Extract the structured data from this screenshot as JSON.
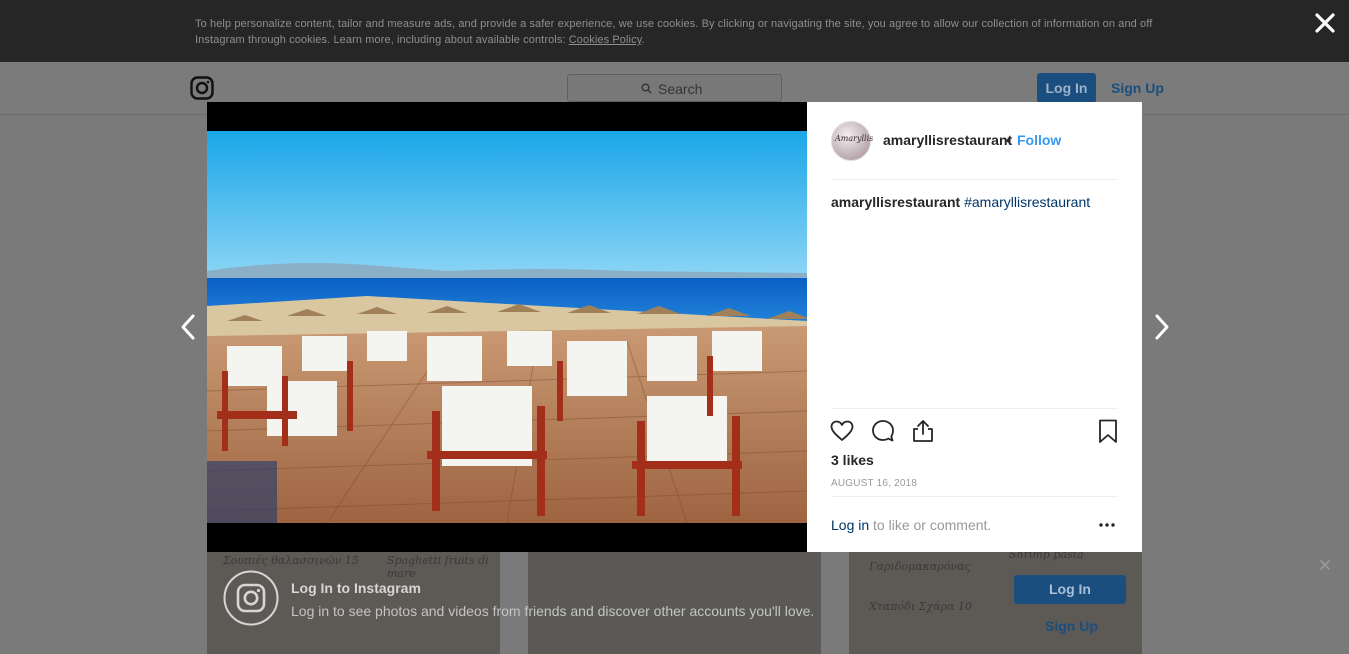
{
  "cookie_banner": {
    "text": "To help personalize content, tailor and measure ads, and provide a safer experience, we use cookies. By clicking or navigating the site, you agree to allow our collection of information on and off Instagram through cookies. Learn more, including about available controls: ",
    "link_label": "Cookies Policy",
    "tail": ".",
    "close_icon": "close-icon"
  },
  "topnav": {
    "search_placeholder": "Search",
    "login_label": "Log In",
    "signup_label": "Sign Up"
  },
  "post": {
    "username": "amaryllisrestaurant",
    "separator": "•",
    "follow_label": "Follow",
    "avatar_text": "Amaryllis",
    "caption_user": "amaryllisrestaurant",
    "caption_hashtag": "#amaryllisrestaurant",
    "likes": "3 likes",
    "date": "AUGUST 16, 2018",
    "login_link": "Log in",
    "login_rest": " to like or comment."
  },
  "background_grid": {
    "cell1": [
      "Σουπιές θαλασσινών 15",
      "Spaghetti fruits di mare"
    ],
    "cell3": [
      "Γαριδομακαρόνας",
      "Χταπόδι Σχάρα 10",
      "Shrimp pasta"
    ]
  },
  "login_strip": {
    "title": "Log In to Instagram",
    "subtitle": "Log in to see photos and videos from friends and discover other accounts you'll love.",
    "login_label": "Log In",
    "signup_label": "Sign Up"
  },
  "colors": {
    "link_blue": "#3897f0",
    "hashtag_blue": "#003569",
    "text_dark": "#262626",
    "meta_gray": "#999999"
  }
}
